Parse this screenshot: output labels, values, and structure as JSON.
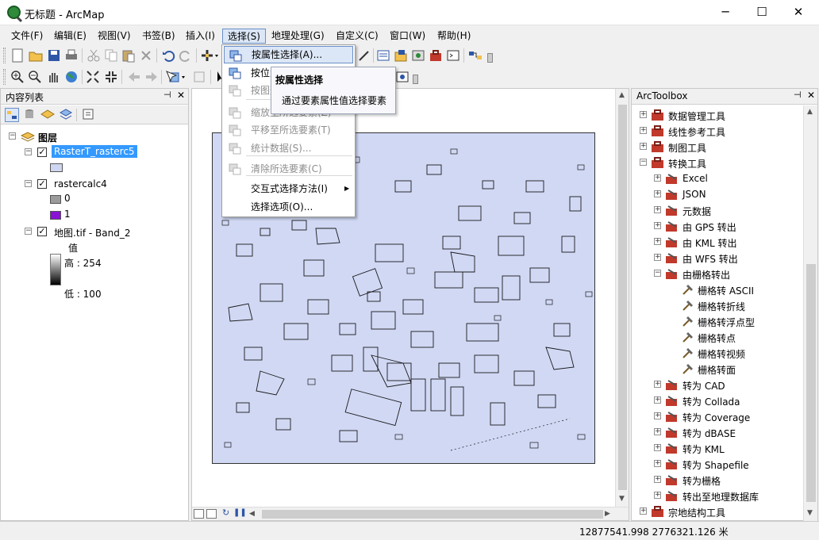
{
  "window": {
    "title": "无标题 - ArcMap",
    "minimize": "─",
    "maximize": "☐",
    "close": "✕"
  },
  "menu": [
    "文件(F)",
    "编辑(E)",
    "视图(V)",
    "书签(B)",
    "插入(I)",
    "选择(S)",
    "地理处理(G)",
    "自定义(C)",
    "窗口(W)",
    "帮助(H)"
  ],
  "dropdown": {
    "items": [
      {
        "label": "按属性选择(A)...",
        "enabled": true,
        "highlighted": true
      },
      {
        "label": "按位置选择(L)...",
        "enabled": true
      },
      {
        "label": "按图形选择(G)",
        "enabled": false
      },
      {
        "label": "缩放至所选要素(Z)",
        "enabled": false
      },
      {
        "label": "平移至所选要素(T)",
        "enabled": false
      },
      {
        "label": "统计数据(S)...",
        "enabled": false
      },
      {
        "label": "清除所选要素(C)",
        "enabled": false
      },
      {
        "label": "交互式选择方法(I)",
        "enabled": true,
        "submenu": true
      },
      {
        "label": "选择选项(O)...",
        "enabled": true
      }
    ],
    "submenu_arrow": "▶"
  },
  "tooltip": {
    "title": "按属性选择",
    "body": "通过要素属性值选择要素"
  },
  "toc": {
    "title": "内容列表",
    "pin": "📌",
    "close": "✕",
    "root": "图层",
    "layers": [
      {
        "name": "RasterT_rasterc5",
        "checked": true,
        "selected": true
      },
      {
        "name": "rastercalc4",
        "checked": true,
        "legend": [
          {
            "label": "0",
            "color": "#9b9b9b"
          },
          {
            "label": "1",
            "color": "#8a12d6"
          }
        ]
      },
      {
        "name": "地图.tif - Band_2",
        "checked": true,
        "value_label": "值",
        "high": "高 : 254",
        "low": "低 : 100"
      }
    ],
    "layer1_swatch": "#ced6f1"
  },
  "toolbox": {
    "title": "ArcToolbox",
    "items": [
      {
        "label": "数据管理工具",
        "level": 0,
        "exp": "+",
        "kind": "box"
      },
      {
        "label": "线性参考工具",
        "level": 0,
        "exp": "+",
        "kind": "box"
      },
      {
        "label": "制图工具",
        "level": 0,
        "exp": "+",
        "kind": "box"
      },
      {
        "label": "转换工具",
        "level": 0,
        "exp": "−",
        "kind": "box"
      },
      {
        "label": "Excel",
        "level": 1,
        "exp": "+",
        "kind": "set"
      },
      {
        "label": "JSON",
        "level": 1,
        "exp": "+",
        "kind": "set"
      },
      {
        "label": "元数据",
        "level": 1,
        "exp": "+",
        "kind": "set"
      },
      {
        "label": "由 GPS 转出",
        "level": 1,
        "exp": "+",
        "kind": "set"
      },
      {
        "label": "由 KML 转出",
        "level": 1,
        "exp": "+",
        "kind": "set"
      },
      {
        "label": "由 WFS 转出",
        "level": 1,
        "exp": "+",
        "kind": "set"
      },
      {
        "label": "由栅格转出",
        "level": 1,
        "exp": "−",
        "kind": "set"
      },
      {
        "label": "栅格转 ASCII",
        "level": 2,
        "exp": "",
        "kind": "tool"
      },
      {
        "label": "栅格转折线",
        "level": 2,
        "exp": "",
        "kind": "tool"
      },
      {
        "label": "栅格转浮点型",
        "level": 2,
        "exp": "",
        "kind": "tool"
      },
      {
        "label": "栅格转点",
        "level": 2,
        "exp": "",
        "kind": "tool"
      },
      {
        "label": "栅格转视频",
        "level": 2,
        "exp": "",
        "kind": "tool"
      },
      {
        "label": "栅格转面",
        "level": 2,
        "exp": "",
        "kind": "tool"
      },
      {
        "label": "转为 CAD",
        "level": 1,
        "exp": "+",
        "kind": "set"
      },
      {
        "label": "转为 Collada",
        "level": 1,
        "exp": "+",
        "kind": "set"
      },
      {
        "label": "转为 Coverage",
        "level": 1,
        "exp": "+",
        "kind": "set"
      },
      {
        "label": "转为 dBASE",
        "level": 1,
        "exp": "+",
        "kind": "set"
      },
      {
        "label": "转为 KML",
        "level": 1,
        "exp": "+",
        "kind": "set"
      },
      {
        "label": "转为 Shapefile",
        "level": 1,
        "exp": "+",
        "kind": "set"
      },
      {
        "label": "转为栅格",
        "level": 1,
        "exp": "+",
        "kind": "set"
      },
      {
        "label": "转出至地理数据库",
        "level": 1,
        "exp": "+",
        "kind": "set"
      },
      {
        "label": "宗地结构工具",
        "level": 0,
        "exp": "+",
        "kind": "box"
      }
    ]
  },
  "status": {
    "coords": "12877541.998  2776321.126 米"
  },
  "colors": {
    "map_fill": "#d0d8f4",
    "selection": "#3399ff",
    "highlight": "#dbe6f6"
  }
}
